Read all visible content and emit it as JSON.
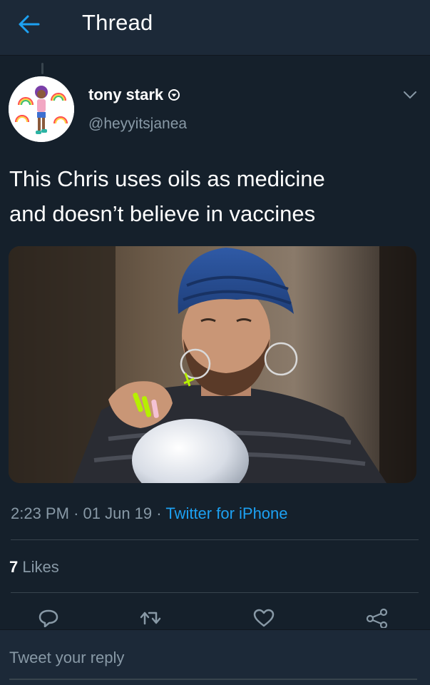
{
  "header": {
    "title": "Thread",
    "back_icon": "arrow-left-icon"
  },
  "tweet": {
    "display_name": "tony stark",
    "handle": "@heyyitsjanea",
    "badge_icon": "verified-badge-icon",
    "text_line1": "This Chris uses oils as medicine",
    "text_line2": "and doesn’t believe in vaccines",
    "time": "2:23 PM",
    "date": "01 Jun 19",
    "separator": "·",
    "source": "Twitter for iPhone",
    "likes_count": "7",
    "likes_label": "Likes"
  },
  "actions": [
    "reply-icon",
    "retweet-icon",
    "like-icon",
    "share-icon"
  ],
  "reply": {
    "placeholder": "Tweet your reply"
  },
  "colors": {
    "background": "#15202b",
    "bar": "#1c2938",
    "accent": "#1da1f2",
    "muted": "#8899a6",
    "divider": "#38444d"
  }
}
